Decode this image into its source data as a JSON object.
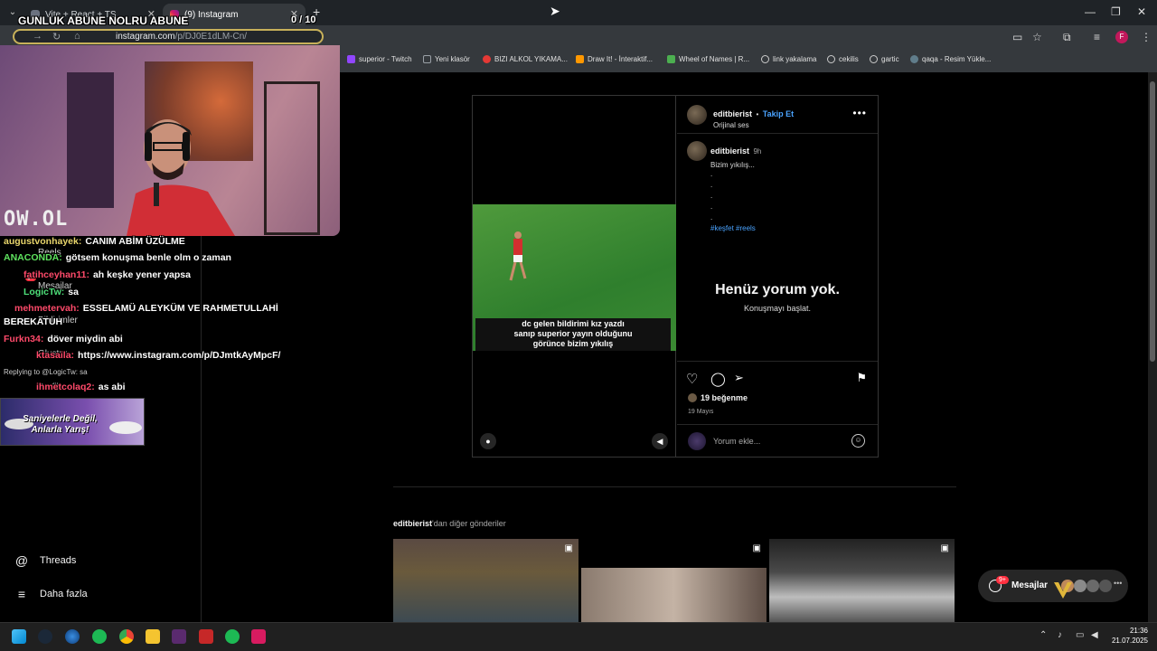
{
  "browser": {
    "tabs": [
      {
        "label": "Vite + React + TS",
        "active": false
      },
      {
        "label": "(9) Instagram",
        "active": true
      }
    ],
    "new_tab": "+",
    "url_host": "instagram.com",
    "url_path": "/p/DJ0E1dLM-Cn/",
    "window_controls": [
      "—",
      "❐",
      "✕"
    ],
    "profile_initial": "F",
    "bookmarks": [
      {
        "label": "superior - Twitch",
        "color": "#9146ff"
      },
      {
        "label": "Yeni klasör",
        "color": "#9aa0a6"
      },
      {
        "label": "BIZI ALKOL YIKAMA...",
        "color": "#e53935"
      },
      {
        "label": "Draw It! - İnteraktif...",
        "color": "#ff9800"
      },
      {
        "label": "Wheel of Names | R...",
        "color": "#4caf50"
      },
      {
        "label": "link yakalama",
        "color": "#9aa0a6"
      },
      {
        "label": "cekilis",
        "color": "#9aa0a6"
      },
      {
        "label": "gartic",
        "color": "#9aa0a6"
      },
      {
        "label": "qaqa - Resim Yükle...",
        "color": "#607d8b"
      }
    ]
  },
  "stream": {
    "overlay_title": "GUNLUK ABUNE NOLRU ABUNE",
    "counter": "0 / 10",
    "logo_text": "OW.OL",
    "ad_text_line1": "Saniyelerle Değil,",
    "ad_text_line2": "Anlarla Yarış!",
    "reply_note": "Replying to @LogicTw: sa",
    "chat": [
      {
        "user": "augustvonhayek:",
        "msg": "CANIM ABİM ÜZÜLME",
        "color": "#e8d56b"
      },
      {
        "user": "ANACONDA:",
        "msg": "götsem konuşma benle olm o zaman",
        "color": "#5fe35f"
      },
      {
        "user": "fatihceyhan11:",
        "msg": "ah keşke yener yapsa",
        "color": "#ff4a6a"
      },
      {
        "user": "LogicTw:",
        "msg": "sa",
        "color": "#4ee07a"
      },
      {
        "user": "mehmetervah:",
        "msg": "ESSELAMÜ ALEYKÜM VE RAHMETULLAHİ",
        "color": "#ff4a6a"
      },
      {
        "user": "",
        "msg": "BEREKATUH",
        "color": "#ffffff"
      },
      {
        "user": "Furkn34:",
        "msg": "döver miydin abi",
        "color": "#ff4a6a"
      },
      {
        "user": "ktasaila:",
        "msg": "https://www.instagram.com/p/DJmtkAyMpcF/",
        "color": "#ff4a6a"
      },
      {
        "user": "ihmetcolaq2:",
        "msg": "as abi",
        "color": "#ff4a6a"
      }
    ]
  },
  "sidebar": {
    "ghost_items": [
      "Reels",
      "Mesajlar",
      "Bildirimler",
      "Oluştur",
      "Profil"
    ],
    "messages_badge": "9+",
    "items": [
      {
        "label": "Threads",
        "icon": "threads-icon"
      },
      {
        "label": "Daha fazla",
        "icon": "menu-icon"
      }
    ]
  },
  "post": {
    "username": "editbierist",
    "follow_label": "Takip Et",
    "separator": "•",
    "audio": "Orijinal ses",
    "caption_user": "editbierist",
    "caption_time": "9h",
    "caption_text": "Bizim yıkılış...",
    "caption_dots": [
      ".",
      ".",
      ".",
      ".",
      "."
    ],
    "hashtags": "#keşfet #reels",
    "video_caption_lines": [
      "dc gelen bildirimi kız yazdı",
      "sanıp superior yayın olduğunu",
      "görünce bizim yıkılış"
    ],
    "empty_title": "Henüz yorum yok.",
    "empty_sub": "Konuşmayı başlat.",
    "likes": "19 beğenme",
    "date": "19 Mayıs",
    "comment_placeholder": "Yorum ekle..."
  },
  "more": {
    "user": "editbierist",
    "suffix": "'dan diğer gönderiler"
  },
  "messages_pill": {
    "label": "Mesajlar",
    "badge": "9+"
  },
  "taskbar": {
    "time": "21:36",
    "date": "21.07.2025"
  }
}
